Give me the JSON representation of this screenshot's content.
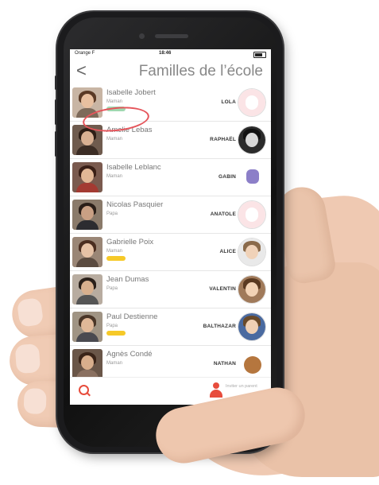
{
  "status": {
    "carrier": "Orange F",
    "time": "18:46"
  },
  "header": {
    "back_label": "<",
    "title": "Familles de l’école"
  },
  "families": [
    {
      "parent": "Isabelle Jobert",
      "role": "Maman",
      "child": "LOLA",
      "tag_color": "#9fd8b0"
    },
    {
      "parent": "Amelie Lebas",
      "role": "Maman",
      "child": "RAPHAËL",
      "tag_color": ""
    },
    {
      "parent": "Isabelle Leblanc",
      "role": "Maman",
      "child": "GABIN",
      "tag_color": ""
    },
    {
      "parent": "Nicolas Pasquier",
      "role": "Papa",
      "child": "ANATOLE",
      "tag_color": ""
    },
    {
      "parent": "Gabrielle Poix",
      "role": "Maman",
      "child": "ALICE",
      "tag_color": "#f6c928"
    },
    {
      "parent": "Jean Dumas",
      "role": "Papa",
      "child": "VALENTIN",
      "tag_color": ""
    },
    {
      "parent": "Paul Destienne",
      "role": "Papa",
      "child": "BALTHAZAR",
      "tag_color": "#f6c928"
    },
    {
      "parent": "Agnès Condé",
      "role": "Maman",
      "child": "NATHAN",
      "tag_color": ""
    }
  ],
  "tabbar": {
    "invite_label": "Inviter un parent"
  },
  "colors": {
    "accent": "#e74c3c",
    "highlight_circle": "#e5555b"
  },
  "icons": {
    "back": "chevron-left-icon",
    "search": "search-icon",
    "invite": "person-add-icon"
  }
}
